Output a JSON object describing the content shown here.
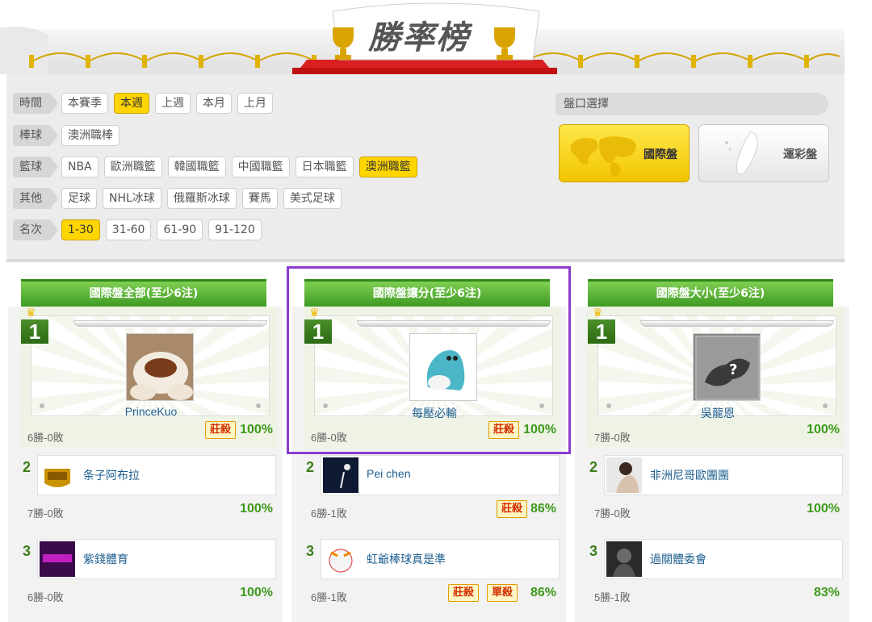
{
  "banner": {
    "title": "勝率榜"
  },
  "filters": {
    "rows": [
      {
        "category": "時間",
        "options": [
          {
            "label": "本賽季",
            "active": false
          },
          {
            "label": "本週",
            "active": true
          },
          {
            "label": "上週",
            "active": false
          },
          {
            "label": "本月",
            "active": false
          },
          {
            "label": "上月",
            "active": false
          }
        ]
      },
      {
        "category": "棒球",
        "options": [
          {
            "label": "澳洲職棒",
            "active": false
          }
        ]
      },
      {
        "category": "籃球",
        "options": [
          {
            "label": "NBA",
            "active": false
          },
          {
            "label": "歐洲職籃",
            "active": false
          },
          {
            "label": "韓國職籃",
            "active": false
          },
          {
            "label": "中國職籃",
            "active": false
          },
          {
            "label": "日本職籃",
            "active": false
          },
          {
            "label": "澳洲職籃",
            "active": true
          }
        ]
      },
      {
        "category": "其他",
        "options": [
          {
            "label": "足球",
            "active": false
          },
          {
            "label": "NHL冰球",
            "active": false
          },
          {
            "label": "俄羅斯冰球",
            "active": false
          },
          {
            "label": "賽馬",
            "active": false
          },
          {
            "label": "美式足球",
            "active": false
          }
        ]
      },
      {
        "category": "名次",
        "options": [
          {
            "label": "1-30",
            "active": true
          },
          {
            "label": "31-60",
            "active": false
          },
          {
            "label": "61-90",
            "active": false
          },
          {
            "label": "91-120",
            "active": false
          }
        ]
      }
    ],
    "pan": {
      "title": "盤口選擇",
      "intl_label": "國際盤",
      "tw_label": "運彩盤"
    }
  },
  "columns": [
    {
      "title": "國際盤全部(至少6注)",
      "first": {
        "rank": "1",
        "name": "PrinceKuo",
        "record": "6勝-0敗",
        "pct": "100%",
        "tags": [
          "莊殺"
        ]
      },
      "others": [
        {
          "rank": "2",
          "name": "条子阿布拉",
          "record": "7勝-0敗",
          "pct": "100%",
          "tags": []
        },
        {
          "rank": "3",
          "name": "紫錢體育",
          "record": "6勝-0敗",
          "pct": "100%",
          "tags": []
        }
      ]
    },
    {
      "title": "國際盤讓分(至少6注)",
      "first": {
        "rank": "1",
        "name": "每壓必輸",
        "record": "6勝-0敗",
        "pct": "100%",
        "tags": [
          "莊殺"
        ]
      },
      "others": [
        {
          "rank": "2",
          "name": "Pei chen",
          "record": "6勝-1敗",
          "pct": "86%",
          "tags": [
            "莊殺"
          ]
        },
        {
          "rank": "3",
          "name": "虹爺棒球真是準",
          "record": "6勝-1敗",
          "pct": "86%",
          "tags": [
            "莊殺",
            "單殺"
          ]
        }
      ]
    },
    {
      "title": "國際盤大小(至少6注)",
      "first": {
        "rank": "1",
        "name": "吳龍恩",
        "record": "7勝-0敗",
        "pct": "100%",
        "tags": []
      },
      "others": [
        {
          "rank": "2",
          "name": "非洲尼哥歐團團",
          "record": "7勝-0敗",
          "pct": "100%",
          "tags": []
        },
        {
          "rank": "3",
          "name": "過關體委會",
          "record": "5勝-1敗",
          "pct": "83%",
          "tags": []
        }
      ]
    }
  ]
}
